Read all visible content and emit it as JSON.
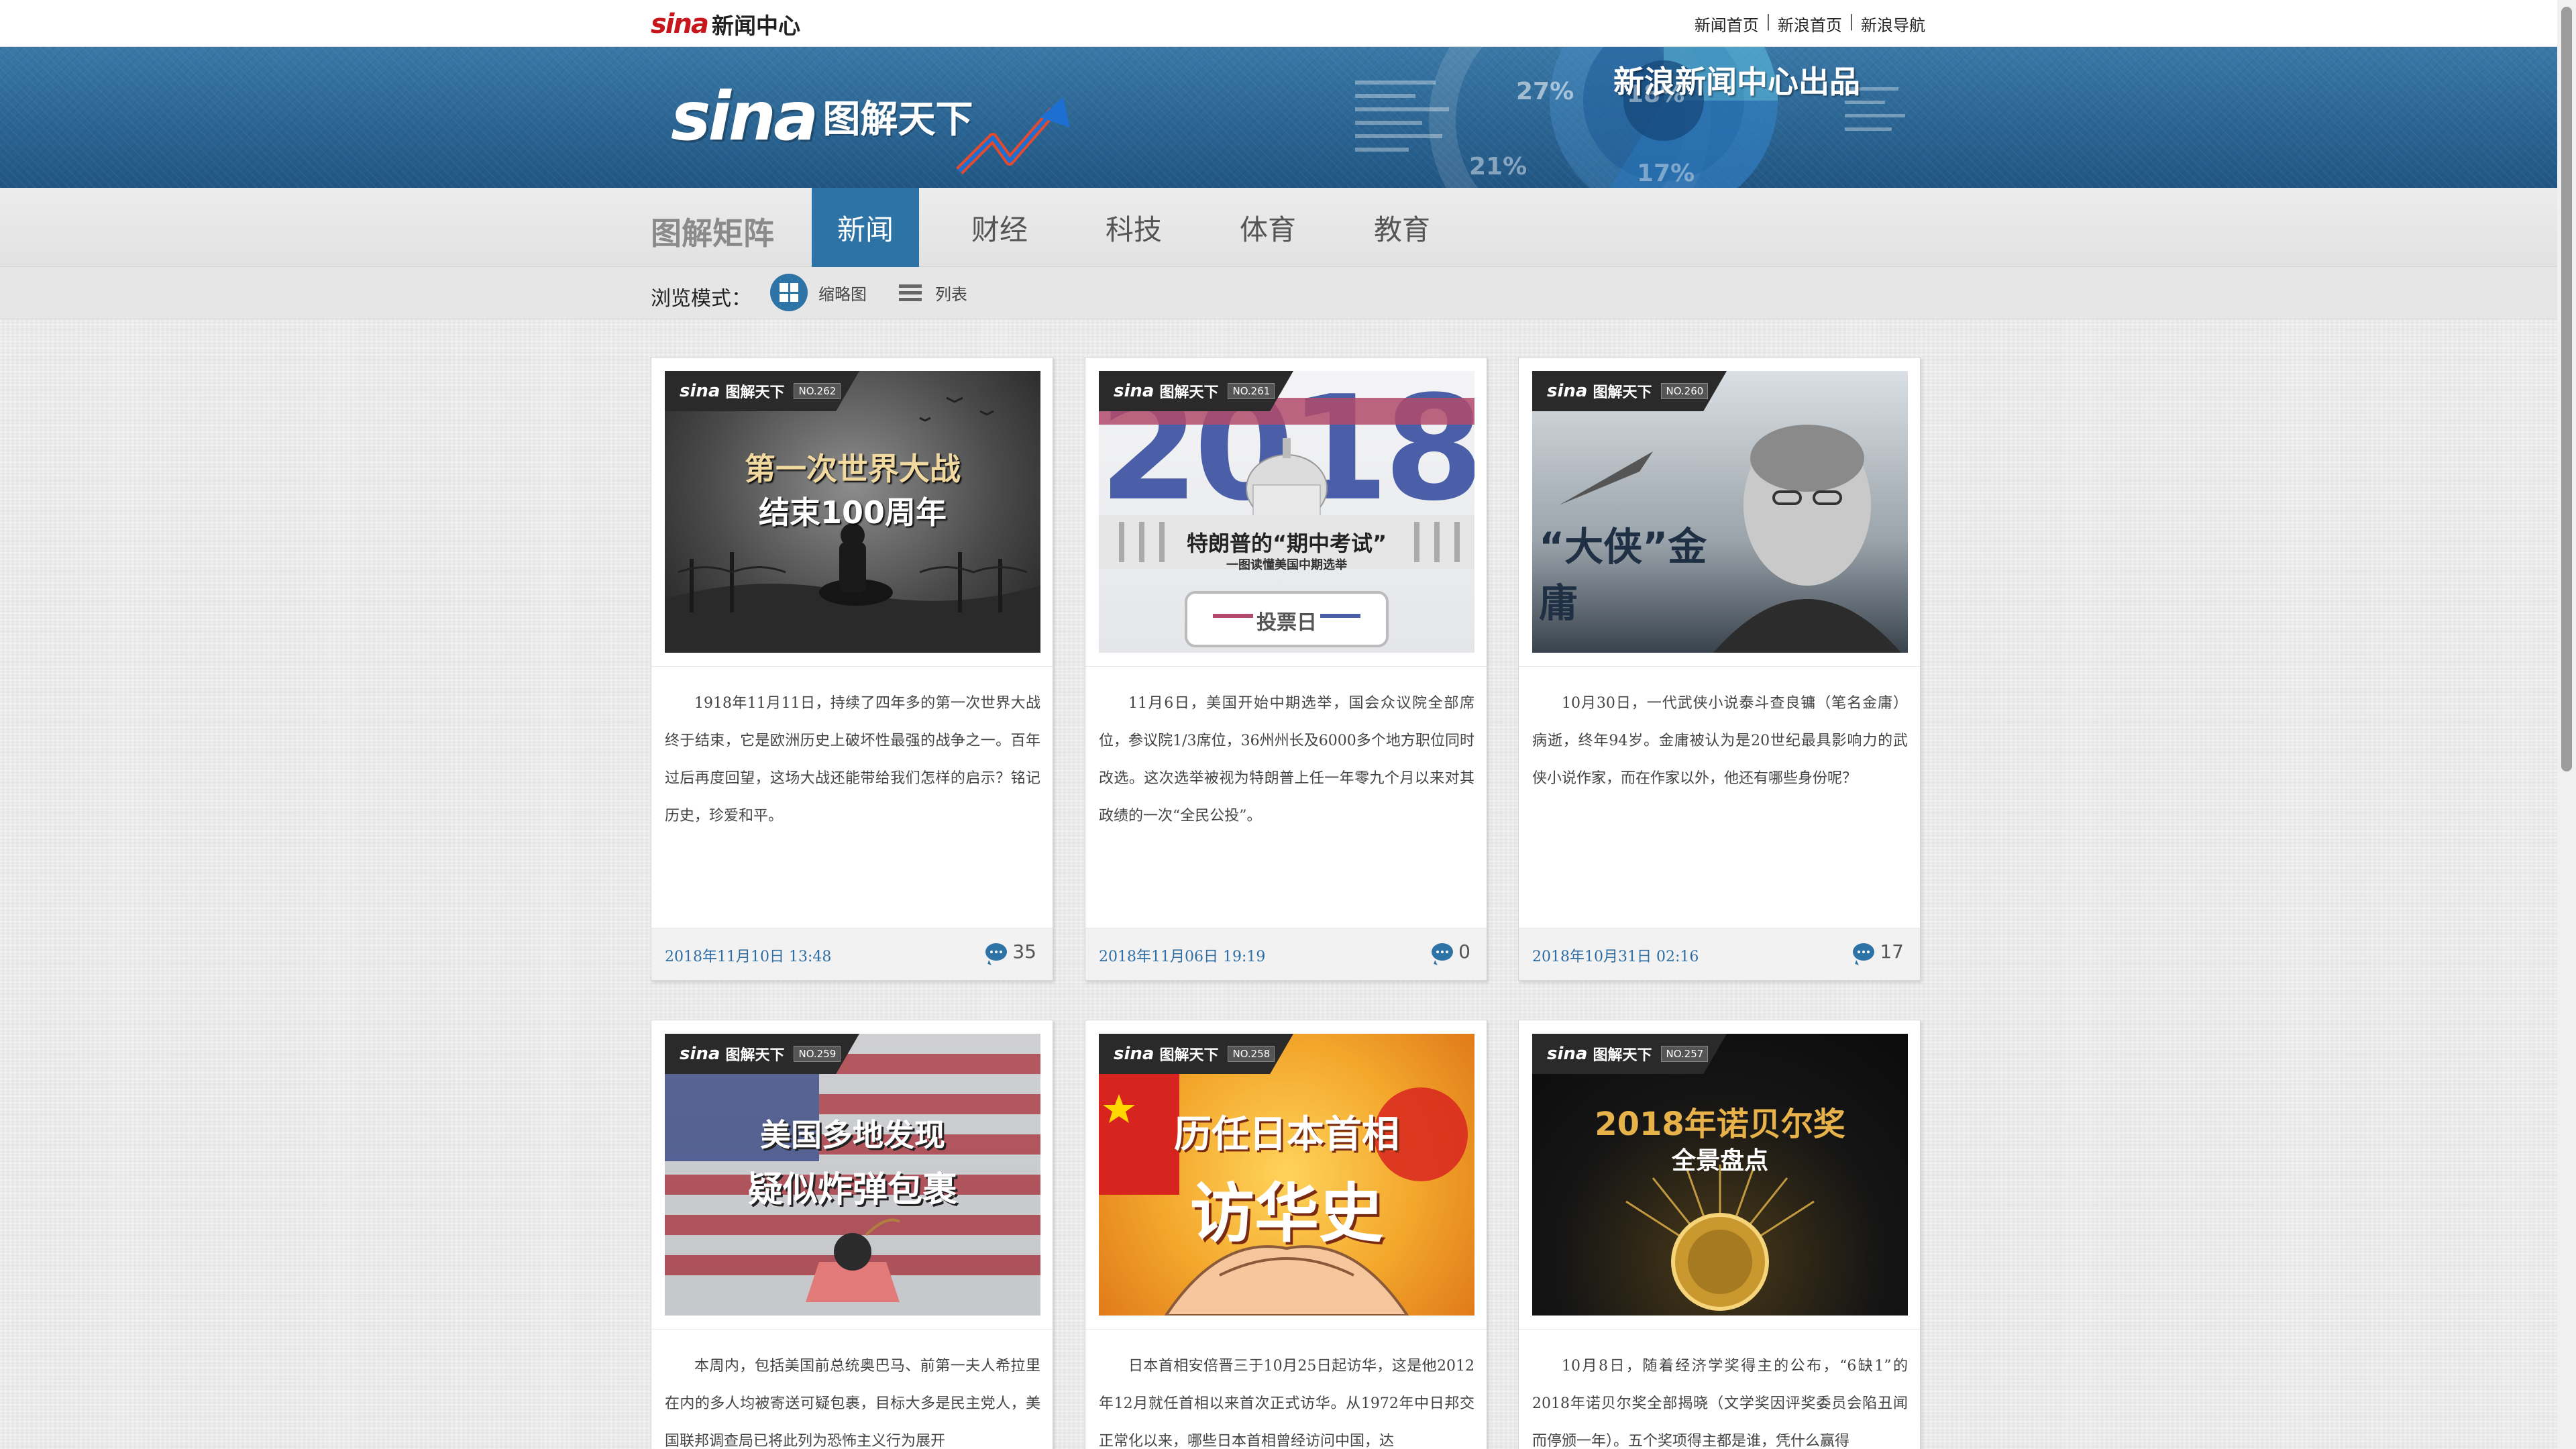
{
  "top_bar": {
    "logo_text": "新闻中心",
    "links": [
      "新闻首页",
      "新浪首页",
      "新浪导航"
    ]
  },
  "banner": {
    "logo_word": "sina",
    "logo_title": "图解天下",
    "credit": "新浪新闻中心出品",
    "chart_labels": [
      "27%",
      "18%",
      "21%",
      "17%"
    ]
  },
  "nav": {
    "title": "图解矩阵",
    "tabs": [
      {
        "label": "新闻",
        "active": true
      },
      {
        "label": "财经",
        "active": false
      },
      {
        "label": "科技",
        "active": false
      },
      {
        "label": "体育",
        "active": false
      },
      {
        "label": "教育",
        "active": false
      }
    ]
  },
  "view_mode": {
    "label": "浏览模式：",
    "grid_label": "缩略图",
    "list_label": "列表"
  },
  "colors": {
    "accent": "#2e73a6",
    "date_text": "#2e6da4"
  },
  "cards": [
    {
      "issue": "NO.262",
      "headline_lines": [
        "第一次世界大战",
        "结束100周年"
      ],
      "description": "1918年11月11日，持续了四年多的第一次世界大战终于结束，它是欧洲历史上破坏性最强的战争之一。百年过后再度回望，这场大战还能带给我们怎样的启示？铭记历史，珍爱和平。",
      "date": "2018年11月10日 13:48",
      "comments": "35"
    },
    {
      "issue": "NO.261",
      "headline_lines": [
        "特朗普的“期中考试”",
        "一图读懂美国中期选举",
        "投票日"
      ],
      "description": "11月6日，美国开始中期选举，国会众议院全部席位，参议院1/3席位，36州州长及6000多个地方职位同时改选。这次选举被视为特朗普上任一年零九个月以来对其政绩的一次“全民公投”。",
      "date": "2018年11月06日 19:19",
      "comments": "0"
    },
    {
      "issue": "NO.260",
      "headline_lines": [
        "“大侠”金庸"
      ],
      "description": "10月30日，一代武侠小说泰斗查良镛（笔名金庸）病逝，终年94岁。金庸被认为是20世纪最具影响力的武侠小说作家，而在作家以外，他还有哪些身份呢？",
      "date": "2018年10月31日 02:16",
      "comments": "17"
    },
    {
      "issue": "NO.259",
      "headline_lines": [
        "美国多地发现",
        "疑似炸弹包裹"
      ],
      "description": "本周内，包括美国前总统奥巴马、前第一夫人希拉里在内的多人均被寄送可疑包裹，目标大多是民主党人，美国联邦调查局已将此列为恐怖主义行为展开",
      "date": "",
      "comments": ""
    },
    {
      "issue": "NO.258",
      "headline_lines": [
        "历任日本首相",
        "访华史"
      ],
      "description": "日本首相安倍晋三于10月25日起访华，这是他2012年12月就任首相以来首次正式访华。从1972年中日邦交正常化以来，哪些日本首相曾经访问中国，达",
      "date": "",
      "comments": ""
    },
    {
      "issue": "NO.257",
      "headline_lines": [
        "2018年诺贝尔奖",
        "全景盘点"
      ],
      "description": "10月8日，随着经济学奖得主的公布，“6缺1”的2018年诺贝尔奖全部揭晓（文学奖因评奖委员会陷丑闻而停颁一年）。五个奖项得主都是谁，凭什么赢得",
      "date": "",
      "comments": ""
    }
  ]
}
